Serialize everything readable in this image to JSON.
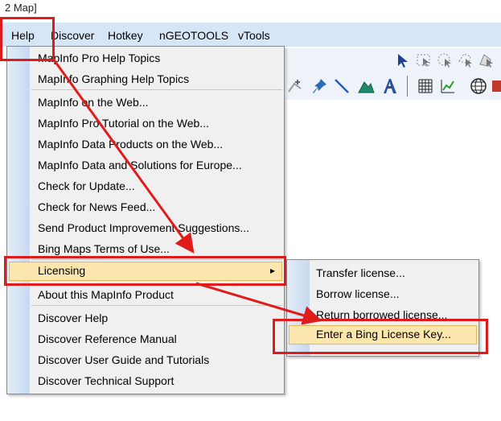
{
  "window": {
    "title_fragment": "2 Map]"
  },
  "menubar": {
    "items": [
      {
        "label": "Help"
      },
      {
        "label": "Discover"
      },
      {
        "label": "Hotkey"
      },
      {
        "label": "nGEOTOOLS"
      },
      {
        "label": "vTools"
      }
    ]
  },
  "help_menu": {
    "items": [
      {
        "label": "MapInfo Pro Help Topics"
      },
      {
        "label": "MapInfo Graphing Help Topics"
      },
      {
        "label": "MapInfo on the Web..."
      },
      {
        "label": "MapInfo Pro Tutorial on the Web..."
      },
      {
        "label": "MapInfo Data Products on the Web..."
      },
      {
        "label": "MapInfo Data and Solutions for Europe..."
      },
      {
        "label": "Check for Update..."
      },
      {
        "label": "Check for News Feed..."
      },
      {
        "label": "Send Product Improvement Suggestions..."
      },
      {
        "label": "Bing Maps Terms of Use..."
      },
      {
        "label": "Licensing"
      },
      {
        "label": "About this MapInfo Product"
      },
      {
        "label": "Discover Help"
      },
      {
        "label": "Discover Reference Manual"
      },
      {
        "label": "Discover User Guide and Tutorials"
      },
      {
        "label": "Discover Technical Support"
      }
    ],
    "submenu_arrow": "▸"
  },
  "licensing_submenu": {
    "items": [
      {
        "label": "Transfer license..."
      },
      {
        "label": "Borrow license..."
      },
      {
        "label": "Return borrowed license..."
      },
      {
        "label": "Enter a Bing License Key..."
      }
    ]
  },
  "annotation": {
    "color": "#e01b1b"
  },
  "toolbar": {
    "icons": [
      "select-arrow-icon",
      "marquee-select-icon",
      "radius-select-icon",
      "polygon-select-icon",
      "boundary-select-icon",
      "add-node-icon",
      "pin-symbol-icon",
      "line-icon",
      "polygon-icon",
      "text-icon",
      "grid-icon",
      "graph-icon",
      "globe-icon",
      "layer-icon"
    ]
  }
}
